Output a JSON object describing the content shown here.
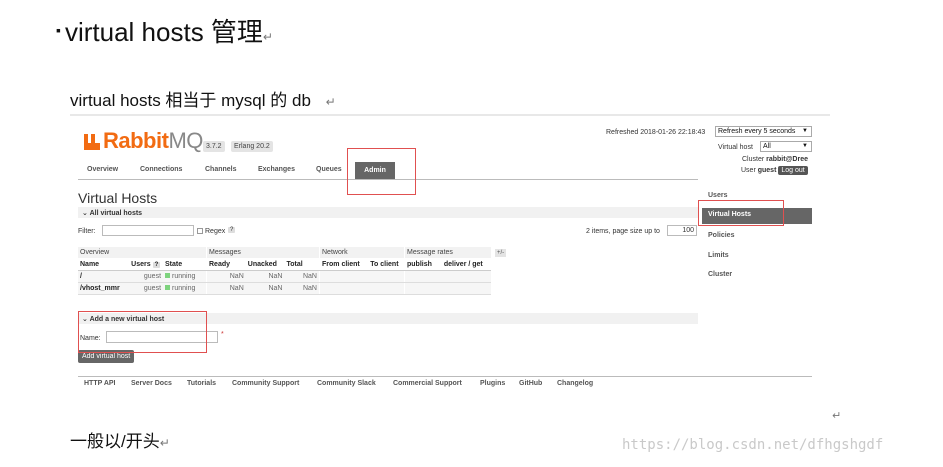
{
  "doc": {
    "heading": "virtual hosts 管理",
    "bullet": "▪",
    "para_mark": "↵",
    "subtitle": "virtual hosts  相当于 mysql 的 db",
    "footer_text": "一般以/开头",
    "watermark": "https://blog.csdn.net/dfhgshgdf"
  },
  "app": {
    "logo_main": "Rabbit",
    "logo_mq": "MQ.",
    "version": "3.7.2",
    "erlang": "Erlang 20.2",
    "refreshed": "Refreshed 2018-01-26 22:18:43",
    "refresh_select": "Refresh every 5 seconds",
    "vhost_label": "Virtual host",
    "vhost_value": "All",
    "cluster_label": "Cluster",
    "cluster_value": "rabbit@Dree",
    "user_label": "User",
    "user_value": "guest",
    "logout": "Log out",
    "nav": [
      "Overview",
      "Connections",
      "Channels",
      "Exchanges",
      "Queues",
      "Admin"
    ],
    "page_title": "Virtual Hosts",
    "section_all": "All virtual hosts",
    "filter_label": "Filter:",
    "regex_label": "Regex",
    "qmark": "?",
    "pagination": "2 items, page size up to",
    "page_size": "100",
    "table": {
      "groups": [
        "Overview",
        "Messages",
        "Network",
        "Message rates",
        "+/-"
      ],
      "headers": [
        "Name",
        "Users",
        "State",
        "Ready",
        "Unacked",
        "Total",
        "From client",
        "To client",
        "publish",
        "deliver / get"
      ],
      "rows": [
        {
          "name": "/",
          "users": "guest",
          "state": "running",
          "ready": "NaN",
          "unacked": "NaN",
          "total": "NaN"
        },
        {
          "name": "/vhost_mmr",
          "users": "guest",
          "state": "running",
          "ready": "NaN",
          "unacked": "NaN",
          "total": "NaN"
        }
      ]
    },
    "add_section": "Add a new virtual host",
    "name_label": "Name:",
    "required_mark": "*",
    "add_button": "Add virtual host",
    "sidebar": [
      "Users",
      "Virtual Hosts",
      "Policies",
      "Limits",
      "Cluster"
    ],
    "footer_links": [
      "HTTP API",
      "Server Docs",
      "Tutorials",
      "Community Support",
      "Community Slack",
      "Commercial Support",
      "Plugins",
      "GitHub",
      "Changelog"
    ]
  },
  "colors": {
    "brand": "#f26b12",
    "highlight_box": "#e05050",
    "active_bg": "#666666"
  }
}
